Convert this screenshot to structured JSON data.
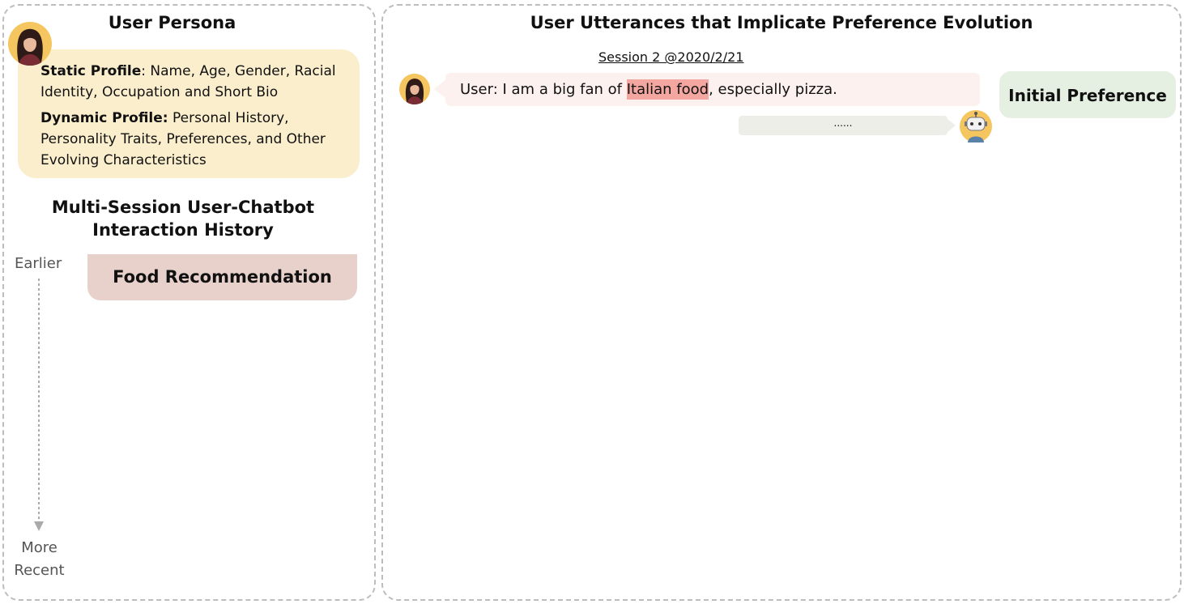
{
  "left_panel": {
    "title": "User Persona",
    "static_profile": {
      "label": "Static Profile",
      "text": ": Name, Age, Gender, Racial Identity, Occupation and Short Bio"
    },
    "dynamic_profile": {
      "label": "Dynamic Profile:",
      "text": " Personal History, Personality Traits, Preferences, and Other Evolving Characteristics"
    },
    "history_title_line1": "Multi-Session User-Chatbot",
    "history_title_line2": "Interaction History",
    "timeline": {
      "start_label": "Earlier",
      "end_label_line1": "More",
      "end_label_line2": "Recent"
    },
    "topic": "Food Recommendation"
  },
  "right_panel": {
    "title": "User Utterances that Implicate Preference Evolution",
    "session_label": "Session 2 @2020/2/21",
    "user_message": {
      "prefix": "User: I am a big fan of ",
      "highlight": "Italian food",
      "suffix": ", especially pizza."
    },
    "bot_message": "......",
    "preference_tag": "Initial Preference"
  },
  "colors": {
    "persona_box": "#fbeecd",
    "topic_box": "#e8d1cb",
    "user_bubble": "#fdf1ef",
    "highlight": "#f4a7a0",
    "bot_bubble": "#eeeee9",
    "preference_tag": "#e5efe2",
    "avatar_bg": "#f5c65f"
  },
  "icons": {
    "user_avatar": "woman-avatar-icon",
    "bot_avatar": "robot-icon"
  }
}
